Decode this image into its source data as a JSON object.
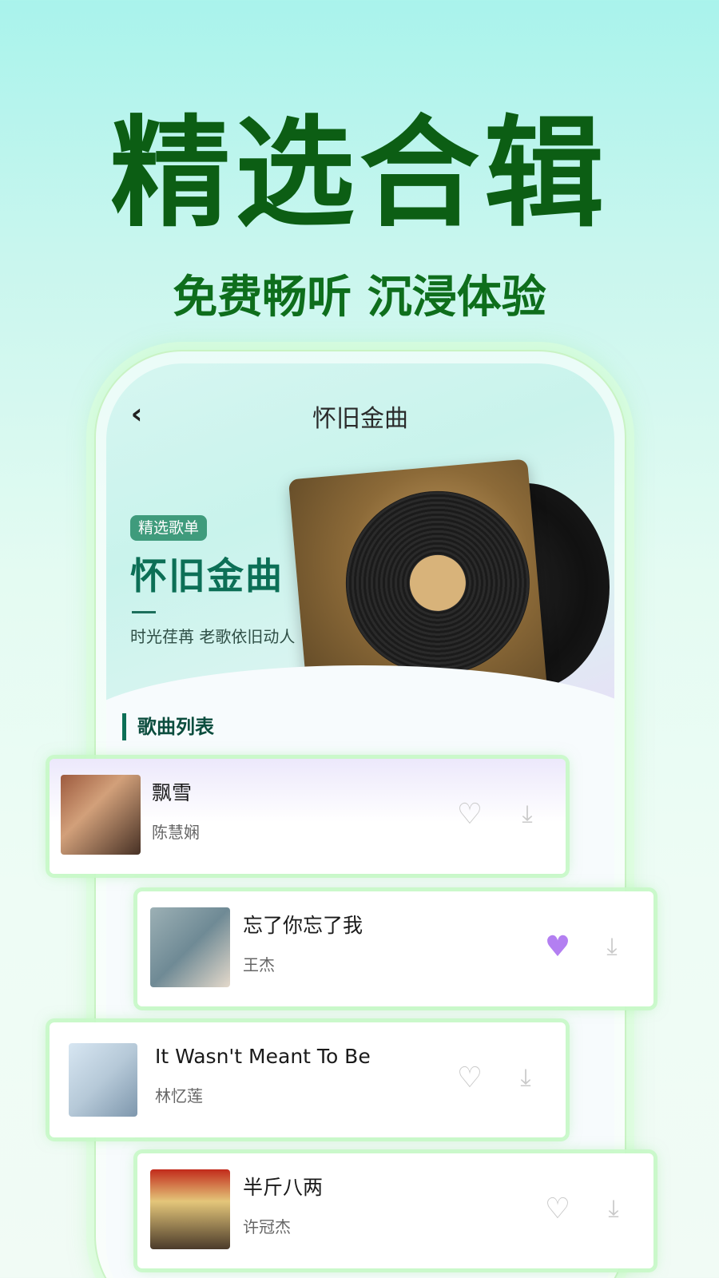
{
  "promo": {
    "headline": "精选合辑",
    "subline": "免费畅听 沉浸体验"
  },
  "header": {
    "title": "怀旧金曲",
    "back_icon": "‹"
  },
  "hero": {
    "tag": "精选歌单",
    "title": "怀旧金曲",
    "subtitle": "时光荏苒 老歌依旧动人"
  },
  "section": {
    "title": "歌曲列表"
  },
  "songs": [
    {
      "name": "飘雪",
      "artist": "陈慧娴",
      "liked": false
    },
    {
      "name": "忘了你忘了我",
      "artist": "王杰",
      "liked": true
    },
    {
      "name": "It Wasn't Meant To Be",
      "artist": "林忆莲",
      "liked": false
    },
    {
      "name": "半斤八两",
      "artist": "许冠杰",
      "liked": false
    }
  ],
  "icons": {
    "heart": "heart-icon",
    "download": "download-icon",
    "back": "back-icon"
  },
  "colors": {
    "headline": "#0c5e14",
    "accent": "#0c6f56",
    "liked": "#b37ff1"
  }
}
